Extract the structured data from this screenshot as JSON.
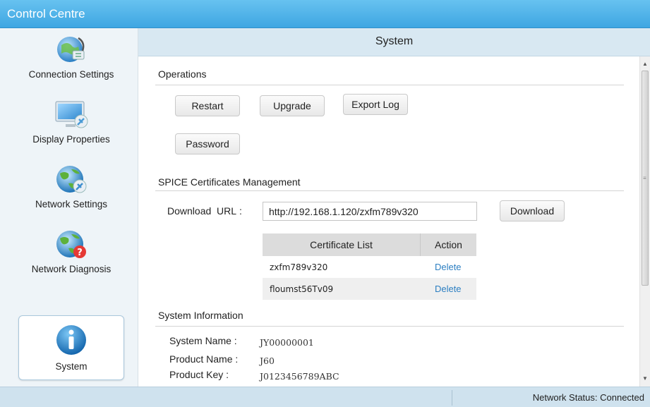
{
  "app": {
    "title": "Control Centre"
  },
  "sidebar": {
    "items": [
      {
        "label": "Connection Settings",
        "icon": "connection-settings-icon"
      },
      {
        "label": "Display Properties",
        "icon": "display-properties-icon"
      },
      {
        "label": "Network Settings",
        "icon": "network-settings-icon"
      },
      {
        "label": "Network Diagnosis",
        "icon": "network-diagnosis-icon"
      },
      {
        "label": "System",
        "icon": "info-icon",
        "active": true
      }
    ]
  },
  "header": {
    "title": "System"
  },
  "operations": {
    "title": "Operations",
    "restart_label": "Restart",
    "upgrade_label": "Upgrade",
    "export_log_label": "Export Log",
    "password_label": "Password"
  },
  "spice": {
    "title": "SPICE Certificates  Management",
    "download_url_label": "Download  URL :",
    "download_url_value": "http://192.168.1.120/zxfm789v320",
    "download_label": "Download",
    "table": {
      "headers": [
        "Certificate List",
        "Action"
      ],
      "rows": [
        {
          "name": "zxfm789v320",
          "action": "Delete"
        },
        {
          "name": "floumst56Tv09",
          "action": "Delete"
        }
      ]
    }
  },
  "system_info": {
    "title": "System Information",
    "rows": [
      {
        "label": "System Name :",
        "value": "JY00000001"
      },
      {
        "label": "Product Name :",
        "value": "J60"
      },
      {
        "label": "Product Key :",
        "value": "J0123456789ABC"
      }
    ]
  },
  "status": {
    "text": "Network Status: Connected"
  },
  "colors": {
    "accent": "#3ea6e2",
    "link": "#2c7fc2",
    "header_bg": "#d8e8f2"
  }
}
